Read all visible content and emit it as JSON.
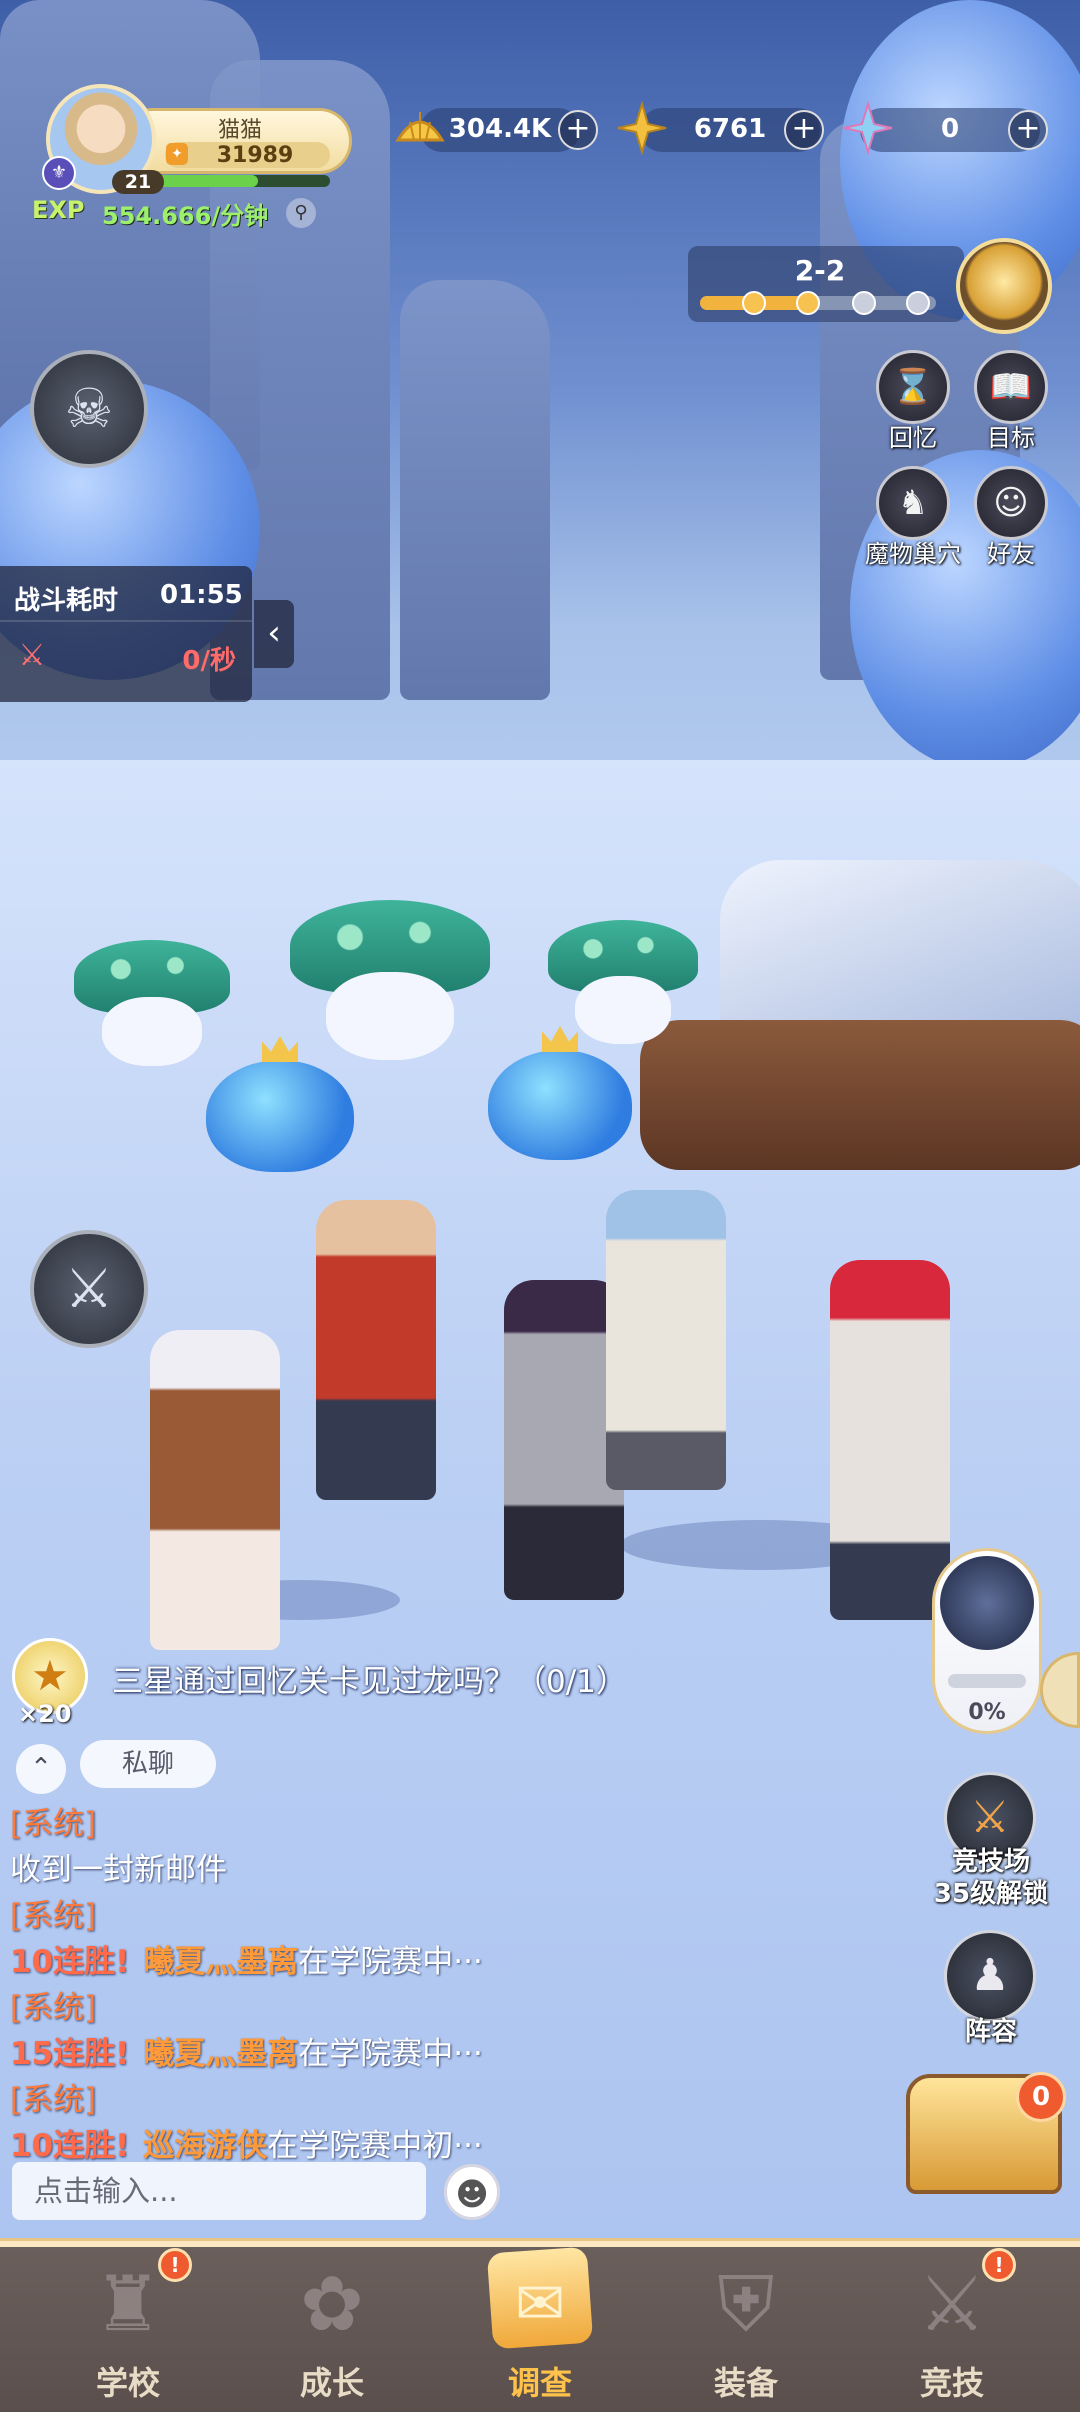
{
  "player": {
    "name": "猫猫",
    "power": "31989",
    "level": "21",
    "level_progress": 0.6,
    "exp_label": "EXP",
    "exp_rate": "554.666/分钟"
  },
  "currencies": [
    {
      "icon": "gold-shell-icon",
      "value": "304.4K"
    },
    {
      "icon": "star-crystal-icon",
      "value": "6761"
    },
    {
      "icon": "prism-star-icon",
      "value": "0"
    }
  ],
  "stage": {
    "label": "2-2",
    "progress": 0.5,
    "nodes_total": 4,
    "nodes_done": 2
  },
  "side_menu": [
    {
      "label": "回忆",
      "icon": "hourglass-icon"
    },
    {
      "label": "目标",
      "icon": "book-icon"
    },
    {
      "label": "魔物巢穴",
      "icon": "dragon-icon"
    },
    {
      "label": "好友",
      "icon": "smiley-icon"
    }
  ],
  "battle": {
    "label": "战斗耗时",
    "time": "01:55",
    "dps": "0/秒"
  },
  "quest": {
    "text": "三星通过回忆关卡见过龙吗？（0/1）",
    "reward_count": "×20"
  },
  "chat": {
    "private_label": "私聊",
    "input_placeholder": "点击输入...",
    "messages": [
      {
        "tag": "[系统]",
        "body": "收到一封新邮件"
      },
      {
        "tag": "[系统]",
        "streak": "10连胜!",
        "player": "曦夏灬墨离",
        "body": "在学院赛中···"
      },
      {
        "tag": "[系统]",
        "streak": "15连胜!",
        "player": "曦夏灬墨离",
        "body": "在学院赛中···"
      },
      {
        "tag": "[系统]",
        "streak": "10连胜!",
        "player": "巡海游侠",
        "body": "在学院赛中初···"
      }
    ]
  },
  "boss": {
    "percent": "0%",
    "progress": 0
  },
  "features": [
    {
      "label": "竞技场\n35级解锁",
      "icon": "crossed-swords-icon"
    },
    {
      "label": "阵容",
      "icon": "chess-icon"
    }
  ],
  "treasure": {
    "badge": "0"
  },
  "bottom_nav": [
    {
      "label": "学校",
      "icon": "castle-icon",
      "alert": "!"
    },
    {
      "label": "成长",
      "icon": "flower-icon",
      "alert": ""
    },
    {
      "label": "调查",
      "icon": "scroll-icon",
      "alert": "",
      "active": true
    },
    {
      "label": "装备",
      "icon": "armor-icon",
      "alert": ""
    },
    {
      "label": "竞技",
      "icon": "sword-icon",
      "alert": "!"
    }
  ],
  "colors": {
    "accent": "#f2b441",
    "alert": "#ef5b2f",
    "exp_green": "#9cf06c",
    "system_tag": "#ff7a3a"
  }
}
